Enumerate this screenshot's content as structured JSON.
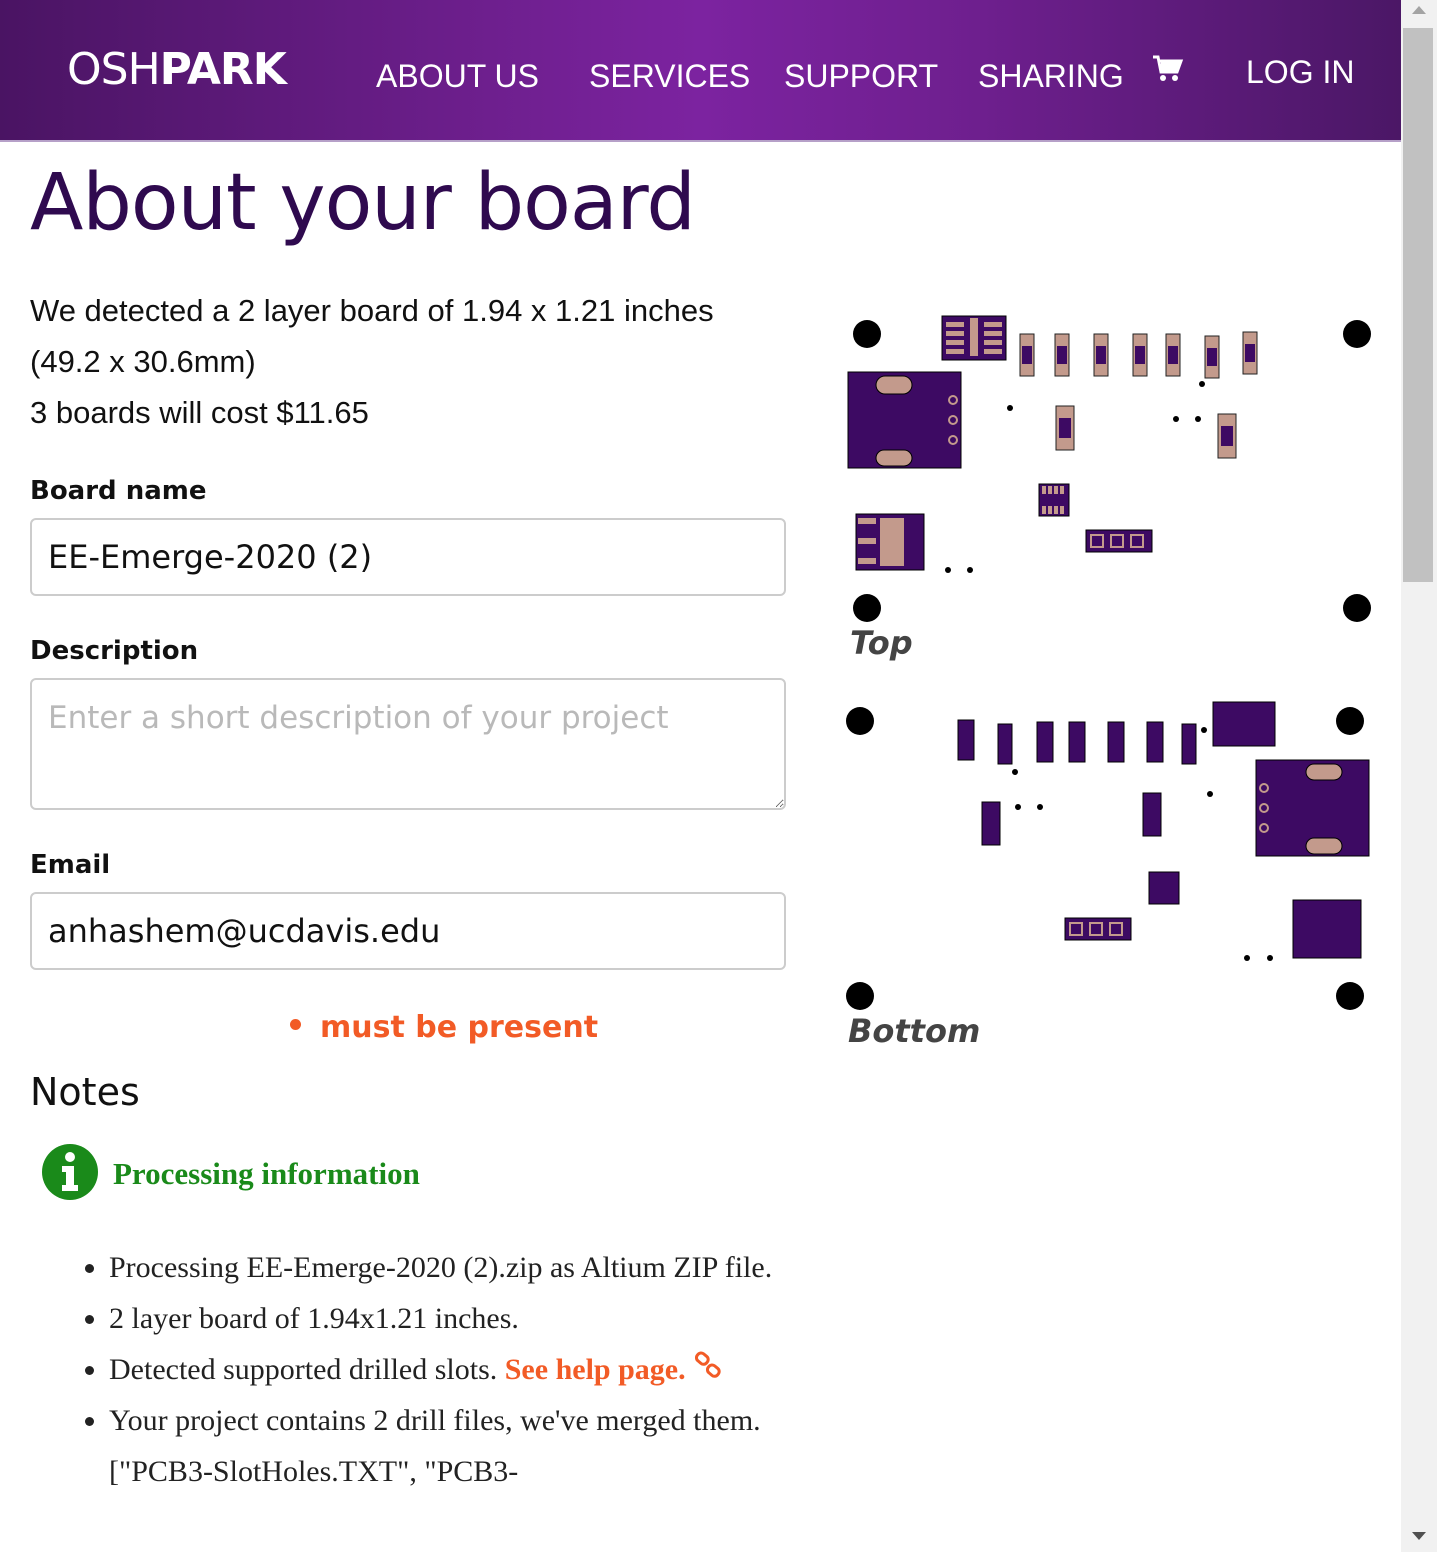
{
  "nav": {
    "logo_light": "OSH",
    "logo_bold": "PARK",
    "links": [
      "ABOUT US",
      "SERVICES",
      "SUPPORT",
      "SHARING"
    ],
    "login": "LOG IN",
    "cart_icon": "cart-icon"
  },
  "page": {
    "title": "About your board",
    "detect_line1": "We detected a 2 layer board of 1.94 x 1.21 inches",
    "detect_line2": "(49.2 x 30.6mm)",
    "detect_line3": "3 boards will cost $11.65"
  },
  "form": {
    "board_name_label": "Board name",
    "board_name_value": "EE-Emerge-2020 (2)",
    "description_label": "Description",
    "description_placeholder": "Enter a short description of your project",
    "email_label": "Email",
    "email_value": "anhashem@ucdavis.edu",
    "error": "must be present"
  },
  "notes": {
    "heading": "Notes",
    "info_title": "Processing information",
    "items": [
      "Processing EE-Emerge-2020 (2).zip as Altium ZIP file.",
      "2 layer board of 1.94x1.21 inches.",
      "Detected supported drilled slots.",
      "Your project contains 2 drill files, we've merged them. [\"PCB3-SlotHoles.TXT\", \"PCB3-"
    ],
    "help_link": "See help page."
  },
  "preview": {
    "top_label": "Top",
    "bottom_label": "Bottom",
    "board_color": "#3d0a63",
    "pad_color": "#c39a8c"
  }
}
